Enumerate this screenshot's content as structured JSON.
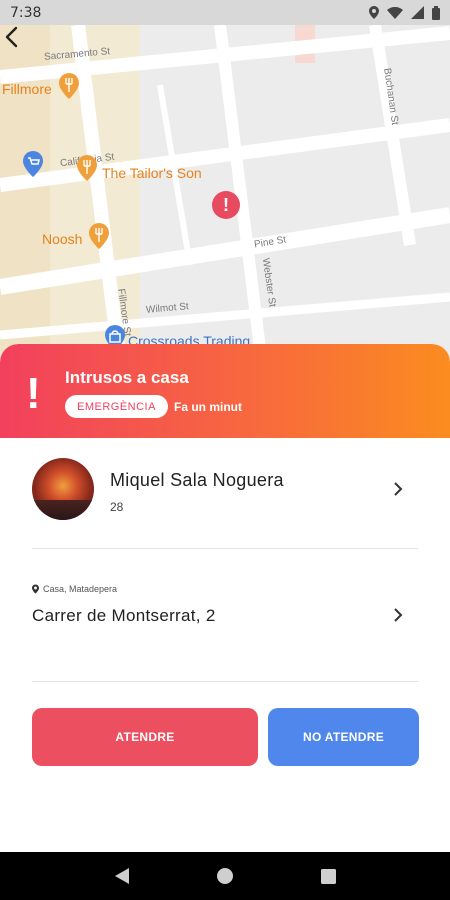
{
  "status_bar": {
    "time": "7:38"
  },
  "map": {
    "streets": [
      "Sacramento St",
      "California St",
      "Pine St",
      "Wilmot St",
      "Fillmore St",
      "Webster St",
      "Buchanan St"
    ],
    "pois": [
      "Fillmore",
      "The Tailor's Son",
      "Noosh",
      "Crossroads Trading"
    ]
  },
  "alert": {
    "mark": "!",
    "title": "Intrusos a casa",
    "badge": "EMERGÈNCIA",
    "time_ago": "Fa un minut"
  },
  "user": {
    "name": "Miquel Sala Noguera",
    "age": "28"
  },
  "location": {
    "label": "Casa, Matadepera",
    "address": "Carrer de Montserrat, 2"
  },
  "actions": {
    "attend": "ATENDRE",
    "not_attend": "NO ATENDRE"
  },
  "colors": {
    "accent_red": "#ec4f5f",
    "accent_blue": "#4f87ec",
    "gradient_start": "#f2405d",
    "gradient_end": "#fb8c1f"
  }
}
